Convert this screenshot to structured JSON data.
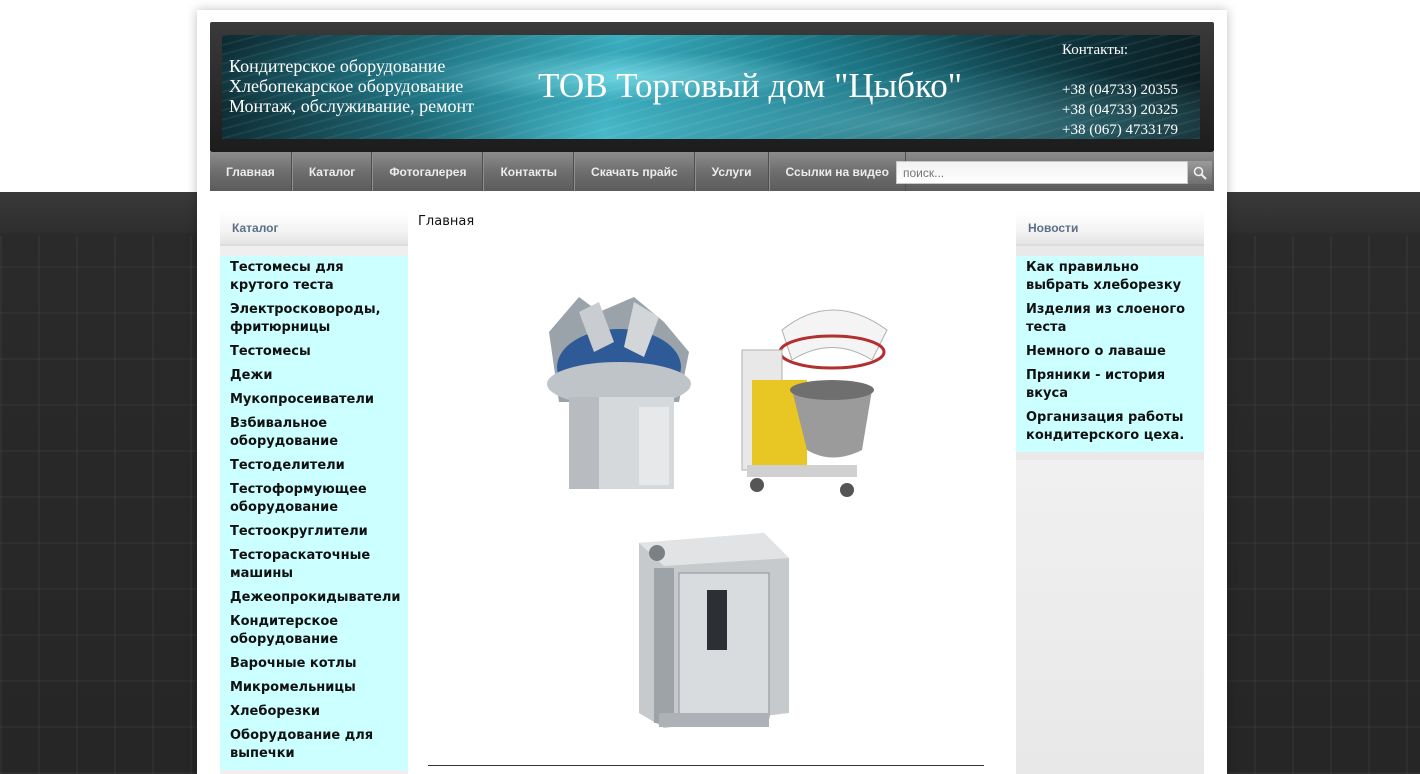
{
  "header": {
    "tagline": [
      "Кондитерское оборудование",
      "Хлебопекарское оборудование",
      "Монтаж, обслуживание, ремонт"
    ],
    "site_title": "ТОВ Торговый дом \"Цыбко\"",
    "contacts_title": "Контакты:",
    "phones": [
      "+38 (04733) 20355",
      "+38 (04733) 20325",
      "+38 (067) 4733179"
    ]
  },
  "nav": {
    "items": [
      "Главная",
      "Каталог",
      "Фотогалерея",
      "Контакты",
      "Скачать прайс",
      "Услуги",
      "Ссылки на видео"
    ]
  },
  "search": {
    "placeholder": "поиск..."
  },
  "sidebar": {
    "title": "Каталог",
    "items": [
      "Тестомесы для крутого теста",
      "Электросковороды, фритюрницы",
      "Тестомесы",
      "Дежи",
      "Мукопросеиватели",
      "Взбивальное оборудование",
      "Тестоделители",
      "Тестоформующее оборудование",
      "Тестоокруглители",
      "Тестораскаточные машины",
      "Дежеопрокидыватели",
      "Кондитерское оборудование",
      "Варочные котлы",
      "Микромельницы",
      "Хлеборезки",
      "Оборудование для выпечки"
    ]
  },
  "main": {
    "breadcrumb": "Главная"
  },
  "news": {
    "title": "Новости",
    "items": [
      "Как правильно выбрать хлеборезку",
      "Изделия из слоеного теста",
      "Немного о лаваше",
      "Пряники - история вкуса",
      "Организация работы кондитерского цеха."
    ]
  },
  "colors": {
    "menu_bg": "#ccffff",
    "nav_bg": "#6e6e6e",
    "heading_text": "#5c6f86",
    "banner_accent": "#3fb3c3"
  },
  "icons": {
    "search": "magnifier-icon"
  }
}
